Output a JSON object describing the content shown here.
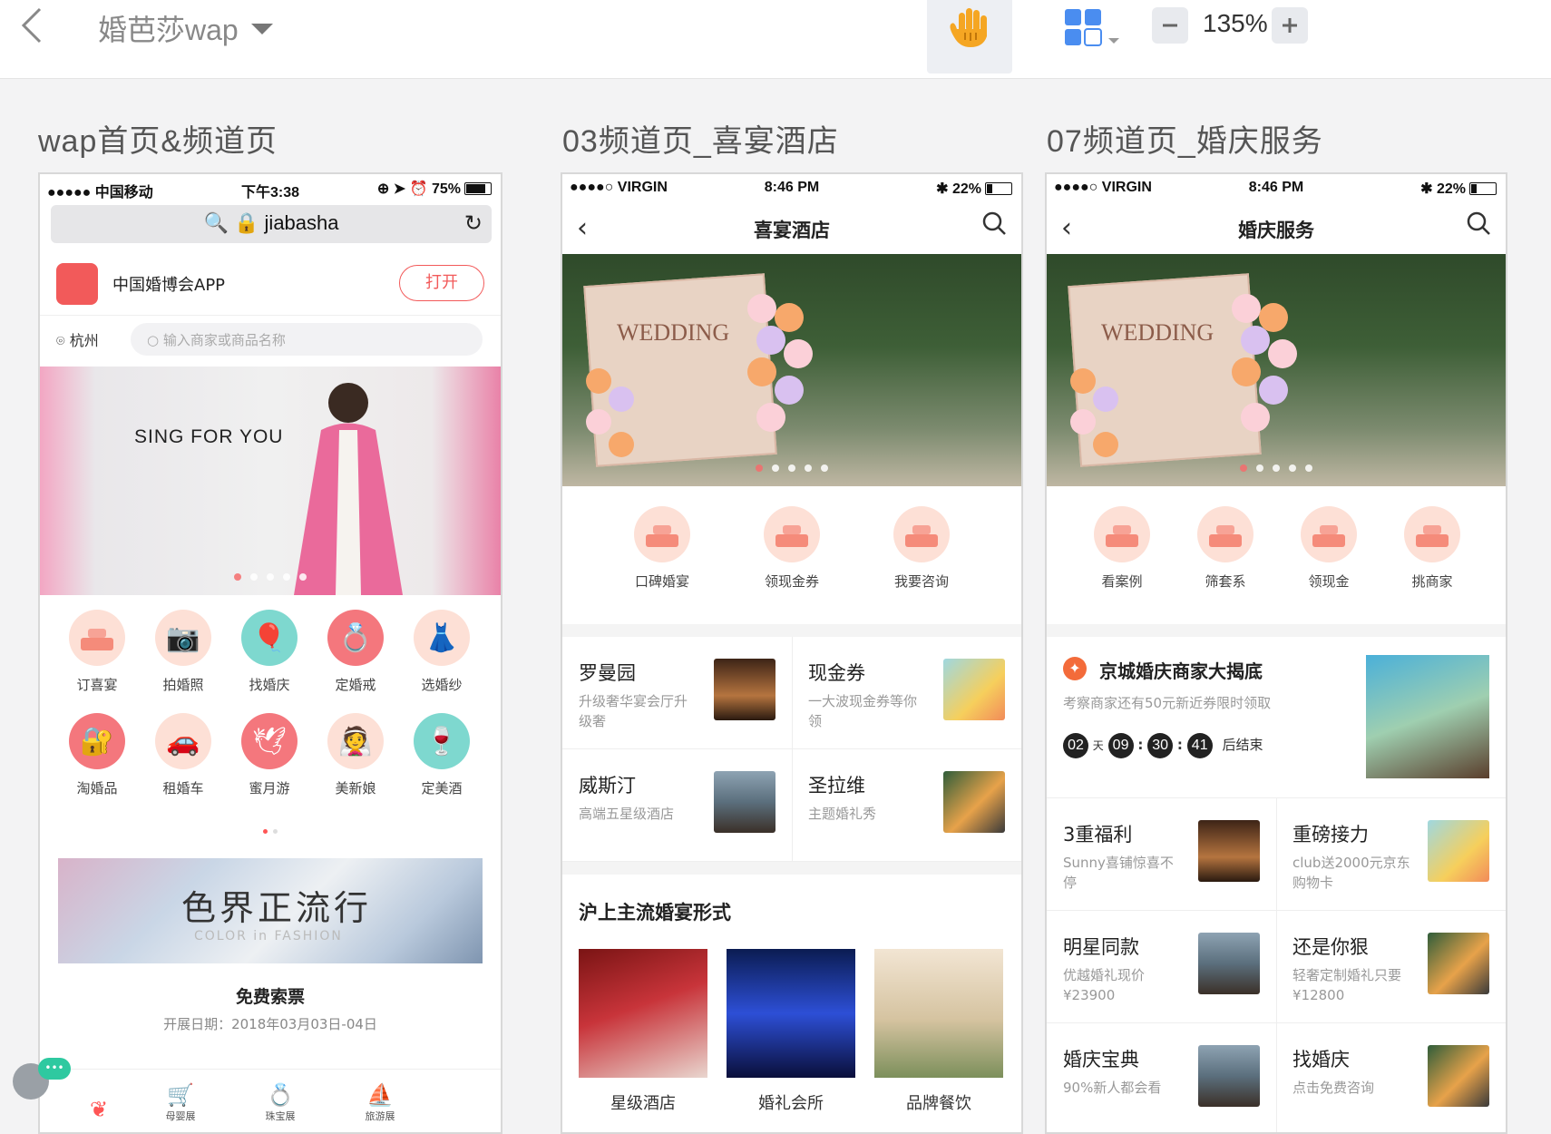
{
  "toolbar": {
    "project_name": "婚芭莎wap",
    "zoom_level": "135%",
    "minus_label": "−",
    "plus_label": "+"
  },
  "pages": [
    {
      "title": "wap首页&频道页",
      "status": {
        "carrier": "●●●●● 中国移动",
        "time": "下午3:38",
        "battery": "75%"
      },
      "url_bar": "jiabasha",
      "app_banner": {
        "name": "中国婚博会APP",
        "button": "打开"
      },
      "location": "杭州",
      "search_placeholder": "输入商家或商品名称",
      "hero_text": "SING FOR YOU",
      "icons": [
        "订喜宴",
        "拍婚照",
        "找婚庆",
        "定婚戒",
        "选婚纱",
        "淘婚品",
        "租婚车",
        "蜜月游",
        "美新娘",
        "定美酒"
      ],
      "promo_text": "色界正流行",
      "promo_sub": "COLOR in FASHION",
      "ticket_title": "免费索票",
      "ticket_date": "开展日期：2018年03月03日-04日",
      "tabs": [
        "母婴展",
        "珠宝展",
        "旅游展"
      ]
    },
    {
      "title": "03频道页_喜宴酒店",
      "status": {
        "carrier": "●●●●○ VIRGIN",
        "time": "8:46 PM",
        "battery": "22%"
      },
      "header": "喜宴酒店",
      "icons": [
        "口碑婚宴",
        "领现金券",
        "我要咨询"
      ],
      "cells": [
        {
          "title": "罗曼园",
          "sub": "升级奢华宴会厅升级奢"
        },
        {
          "title": "现金券",
          "sub": "一大波现金券等你领"
        },
        {
          "title": "威斯汀",
          "sub": "高端五星级酒店"
        },
        {
          "title": "圣拉维",
          "sub": "主题婚礼秀"
        }
      ],
      "section_title": "沪上主流婚宴形式",
      "cards": [
        "星级酒店",
        "婚礼会所",
        "品牌餐饮"
      ]
    },
    {
      "title": "07频道页_婚庆服务",
      "status": {
        "carrier": "●●●●○ VIRGIN",
        "time": "8:46 PM",
        "battery": "22%"
      },
      "header": "婚庆服务",
      "icons": [
        "看案例",
        "筛套系",
        "领现金",
        "挑商家"
      ],
      "deal": {
        "title": "京城婚庆商家大揭底",
        "sub": "考察商家还有50元新近券限时领取",
        "days": "02",
        "day_unit": "天",
        "h": "09",
        "m": "30",
        "s": "41",
        "sep": ":",
        "end": "后结束"
      },
      "cells": [
        {
          "title": "3重福利",
          "sub": "Sunny喜铺惊喜不停"
        },
        {
          "title": "重磅接力",
          "sub": "club送2000元京东购物卡"
        },
        {
          "title": "明星同款",
          "sub": "优越婚礼现价¥23900"
        },
        {
          "title": "还是你狠",
          "sub": "轻奢定制婚礼只要¥12800"
        },
        {
          "title": "婚庆宝典",
          "sub": "90%新人都会看"
        },
        {
          "title": "找婚庆",
          "sub": "点击免费咨询"
        }
      ]
    }
  ]
}
